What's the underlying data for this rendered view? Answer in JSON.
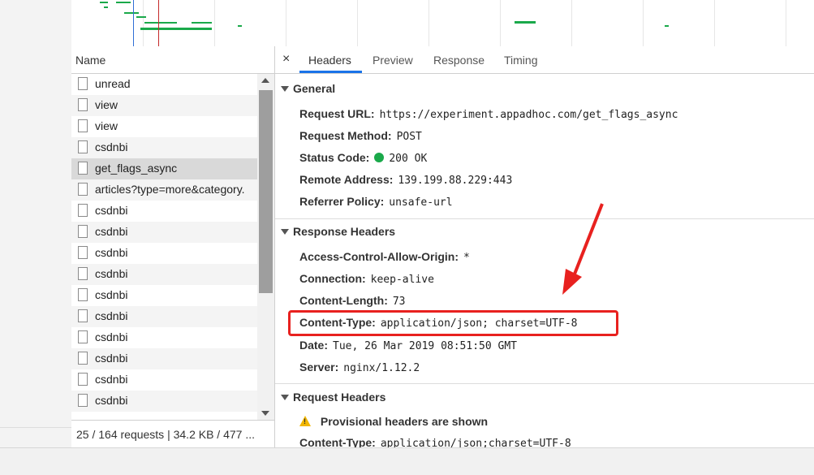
{
  "name_panel": {
    "header": "Name",
    "requests": [
      {
        "name": "unread"
      },
      {
        "name": "view"
      },
      {
        "name": "view"
      },
      {
        "name": "csdnbi"
      },
      {
        "name": "get_flags_async"
      },
      {
        "name": "articles?type=more&category."
      },
      {
        "name": "csdnbi"
      },
      {
        "name": "csdnbi"
      },
      {
        "name": "csdnbi"
      },
      {
        "name": "csdnbi"
      },
      {
        "name": "csdnbi"
      },
      {
        "name": "csdnbi"
      },
      {
        "name": "csdnbi"
      },
      {
        "name": "csdnbi"
      },
      {
        "name": "csdnbi"
      },
      {
        "name": "csdnbi"
      }
    ],
    "selected_index": 4,
    "status": "25 / 164 requests  |  34.2 KB / 477 ..."
  },
  "tabs": {
    "close": "×",
    "items": [
      {
        "label": "Headers"
      },
      {
        "label": "Preview"
      },
      {
        "label": "Response"
      },
      {
        "label": "Timing"
      }
    ],
    "active": "Headers"
  },
  "general": {
    "title": "General",
    "request_url_key": "Request URL:",
    "request_url_val": "https://experiment.appadhoc.com/get_flags_async",
    "request_method_key": "Request Method:",
    "request_method_val": "POST",
    "status_code_key": "Status Code:",
    "status_code_val": "200 OK",
    "remote_address_key": "Remote Address:",
    "remote_address_val": "139.199.88.229:443",
    "referrer_policy_key": "Referrer Policy:",
    "referrer_policy_val": "unsafe-url"
  },
  "response_headers": {
    "title": "Response Headers",
    "acao_key": "Access-Control-Allow-Origin:",
    "acao_val": "*",
    "connection_key": "Connection:",
    "connection_val": "keep-alive",
    "content_length_key": "Content-Length:",
    "content_length_val": "73",
    "content_type_key": "Content-Type:",
    "content_type_val": "application/json; charset=UTF-8",
    "date_key": "Date:",
    "date_val": "Tue, 26 Mar 2019 08:51:50 GMT",
    "server_key": "Server:",
    "server_val": "nginx/1.12.2"
  },
  "request_headers": {
    "title": "Request Headers",
    "provisional": "Provisional headers are shown",
    "content_type_key": "Content-Type:",
    "content_type_val": "application/json;charset=UTF-8"
  },
  "colors": {
    "accent": "#1a73e8",
    "status_ok": "#1aa94a",
    "annotation": "#e8211f",
    "warning": "#f2b600"
  }
}
